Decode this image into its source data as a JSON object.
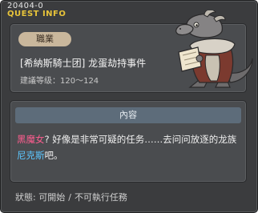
{
  "window": {
    "quest_id": "20404-0",
    "title": "QUEST INFO"
  },
  "quest": {
    "job_label": "職業",
    "name": "[希納斯騎士团] 龙蛋劫持事件",
    "level_range": "建議等级：120～124"
  },
  "content": {
    "header": "內容",
    "segments": [
      {
        "text": "黑魔女",
        "style": "pink"
      },
      {
        "text": "? 好像是非常可疑的任务……去问问放逐的龙族",
        "style": "normal"
      },
      {
        "text": "尼克斯",
        "style": "blue"
      },
      {
        "text": "吧。",
        "style": "normal"
      }
    ]
  },
  "status": {
    "label": "狀態:",
    "value_1": "可開始",
    "separator": "/",
    "value_2": "不可執行任務"
  },
  "npc": {
    "icon": "dragon-npc-portrait"
  },
  "colors": {
    "title_accent": "#e8c43a",
    "pink_highlight": "#ff5d8f",
    "blue_highlight": "#5cc7ff",
    "content_header_bg": "#5d6c7a",
    "job_badge_bg": "#c9b79c"
  }
}
